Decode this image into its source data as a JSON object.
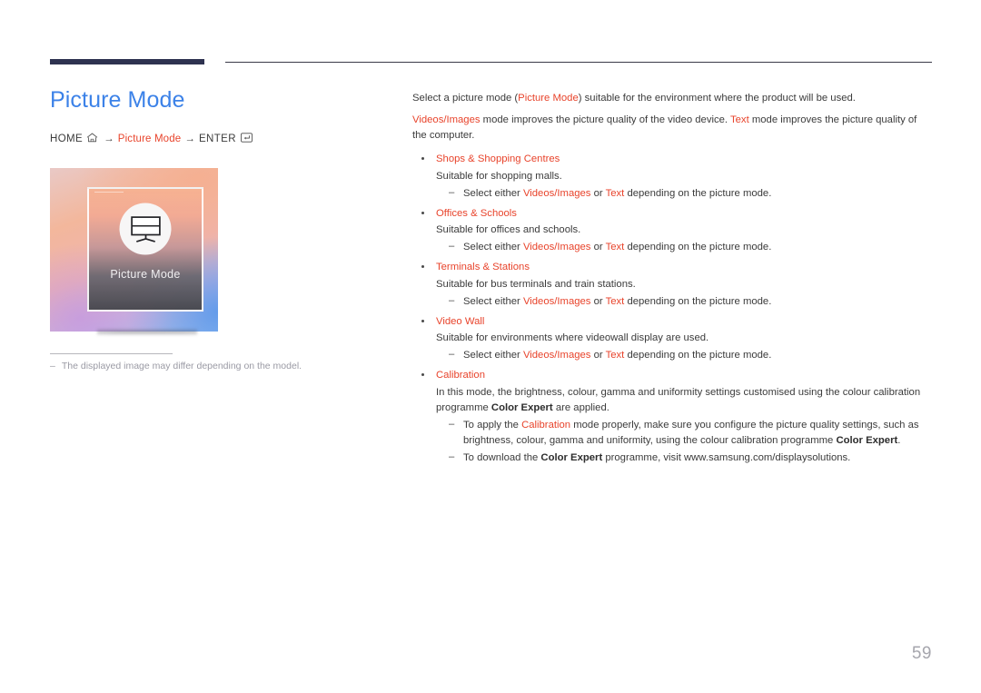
{
  "header": {
    "rule_color": "#2e3250",
    "thin_rule_color": "#3a3a48"
  },
  "title": "Picture Mode",
  "title_color": "#3c82e8",
  "accent_color": "#e8432b",
  "breadcrumb": {
    "home_label": "HOME",
    "home_icon": "home-icon",
    "arrow1": "→",
    "middle_label": "Picture Mode",
    "arrow2": "→",
    "enter_label": "ENTER",
    "enter_icon": "enter-key-icon"
  },
  "thumbnail": {
    "icon_name": "monitor-icon",
    "label": "Picture Mode"
  },
  "caption": {
    "dash": "–",
    "text": "The displayed image may differ depending on the model."
  },
  "intro": {
    "line1_a": "Select a picture mode (",
    "line1_accent": "Picture Mode",
    "line1_b": ") suitable for the environment where the product will be used.",
    "line2_accent1": "Videos/Images",
    "line2_a": " mode improves the picture quality of the video device. ",
    "line2_accent2": "Text",
    "line2_b": " mode improves the picture quality of the computer."
  },
  "bullets": [
    {
      "title": "Shops & Shopping Centres",
      "desc": "Suitable for shopping malls.",
      "sub": {
        "dash": "–",
        "a": "Select either ",
        "accent1": "Videos/Images",
        "b": " or ",
        "accent2": "Text",
        "c": " depending on the picture mode."
      }
    },
    {
      "title": "Offices & Schools",
      "desc": "Suitable for offices and schools.",
      "sub": {
        "dash": "–",
        "a": "Select either ",
        "accent1": "Videos/Images",
        "b": " or ",
        "accent2": "Text",
        "c": " depending on the picture mode."
      }
    },
    {
      "title": "Terminals & Stations",
      "desc": "Suitable for bus terminals and train stations.",
      "sub": {
        "dash": "–",
        "a": "Select either ",
        "accent1": "Videos/Images",
        "b": " or ",
        "accent2": "Text",
        "c": " depending on the picture mode."
      }
    },
    {
      "title": "Video Wall",
      "desc": "Suitable for environments where videowall display are used.",
      "sub": {
        "dash": "–",
        "a": "Select either ",
        "accent1": "Videos/Images",
        "b": " or ",
        "accent2": "Text",
        "c": " depending on the picture mode."
      }
    }
  ],
  "calibration": {
    "title": "Calibration",
    "desc_a": "In this mode, the brightness, colour, gamma and uniformity settings customised using the colour calibration programme ",
    "desc_bold": "Color Expert",
    "desc_b": " are applied.",
    "sub1": {
      "dash": "–",
      "a": "To apply the ",
      "accent": "Calibration",
      "b": " mode properly, make sure you configure the picture quality settings, such as brightness, colour, gamma and uniformity, using the colour calibration programme ",
      "bold": "Color Expert",
      "c": "."
    },
    "sub2": {
      "dash": "–",
      "a": "To download the ",
      "bold": "Color Expert",
      "b": " programme, visit www.samsung.com/displaysolutions."
    }
  },
  "page_number": "59"
}
